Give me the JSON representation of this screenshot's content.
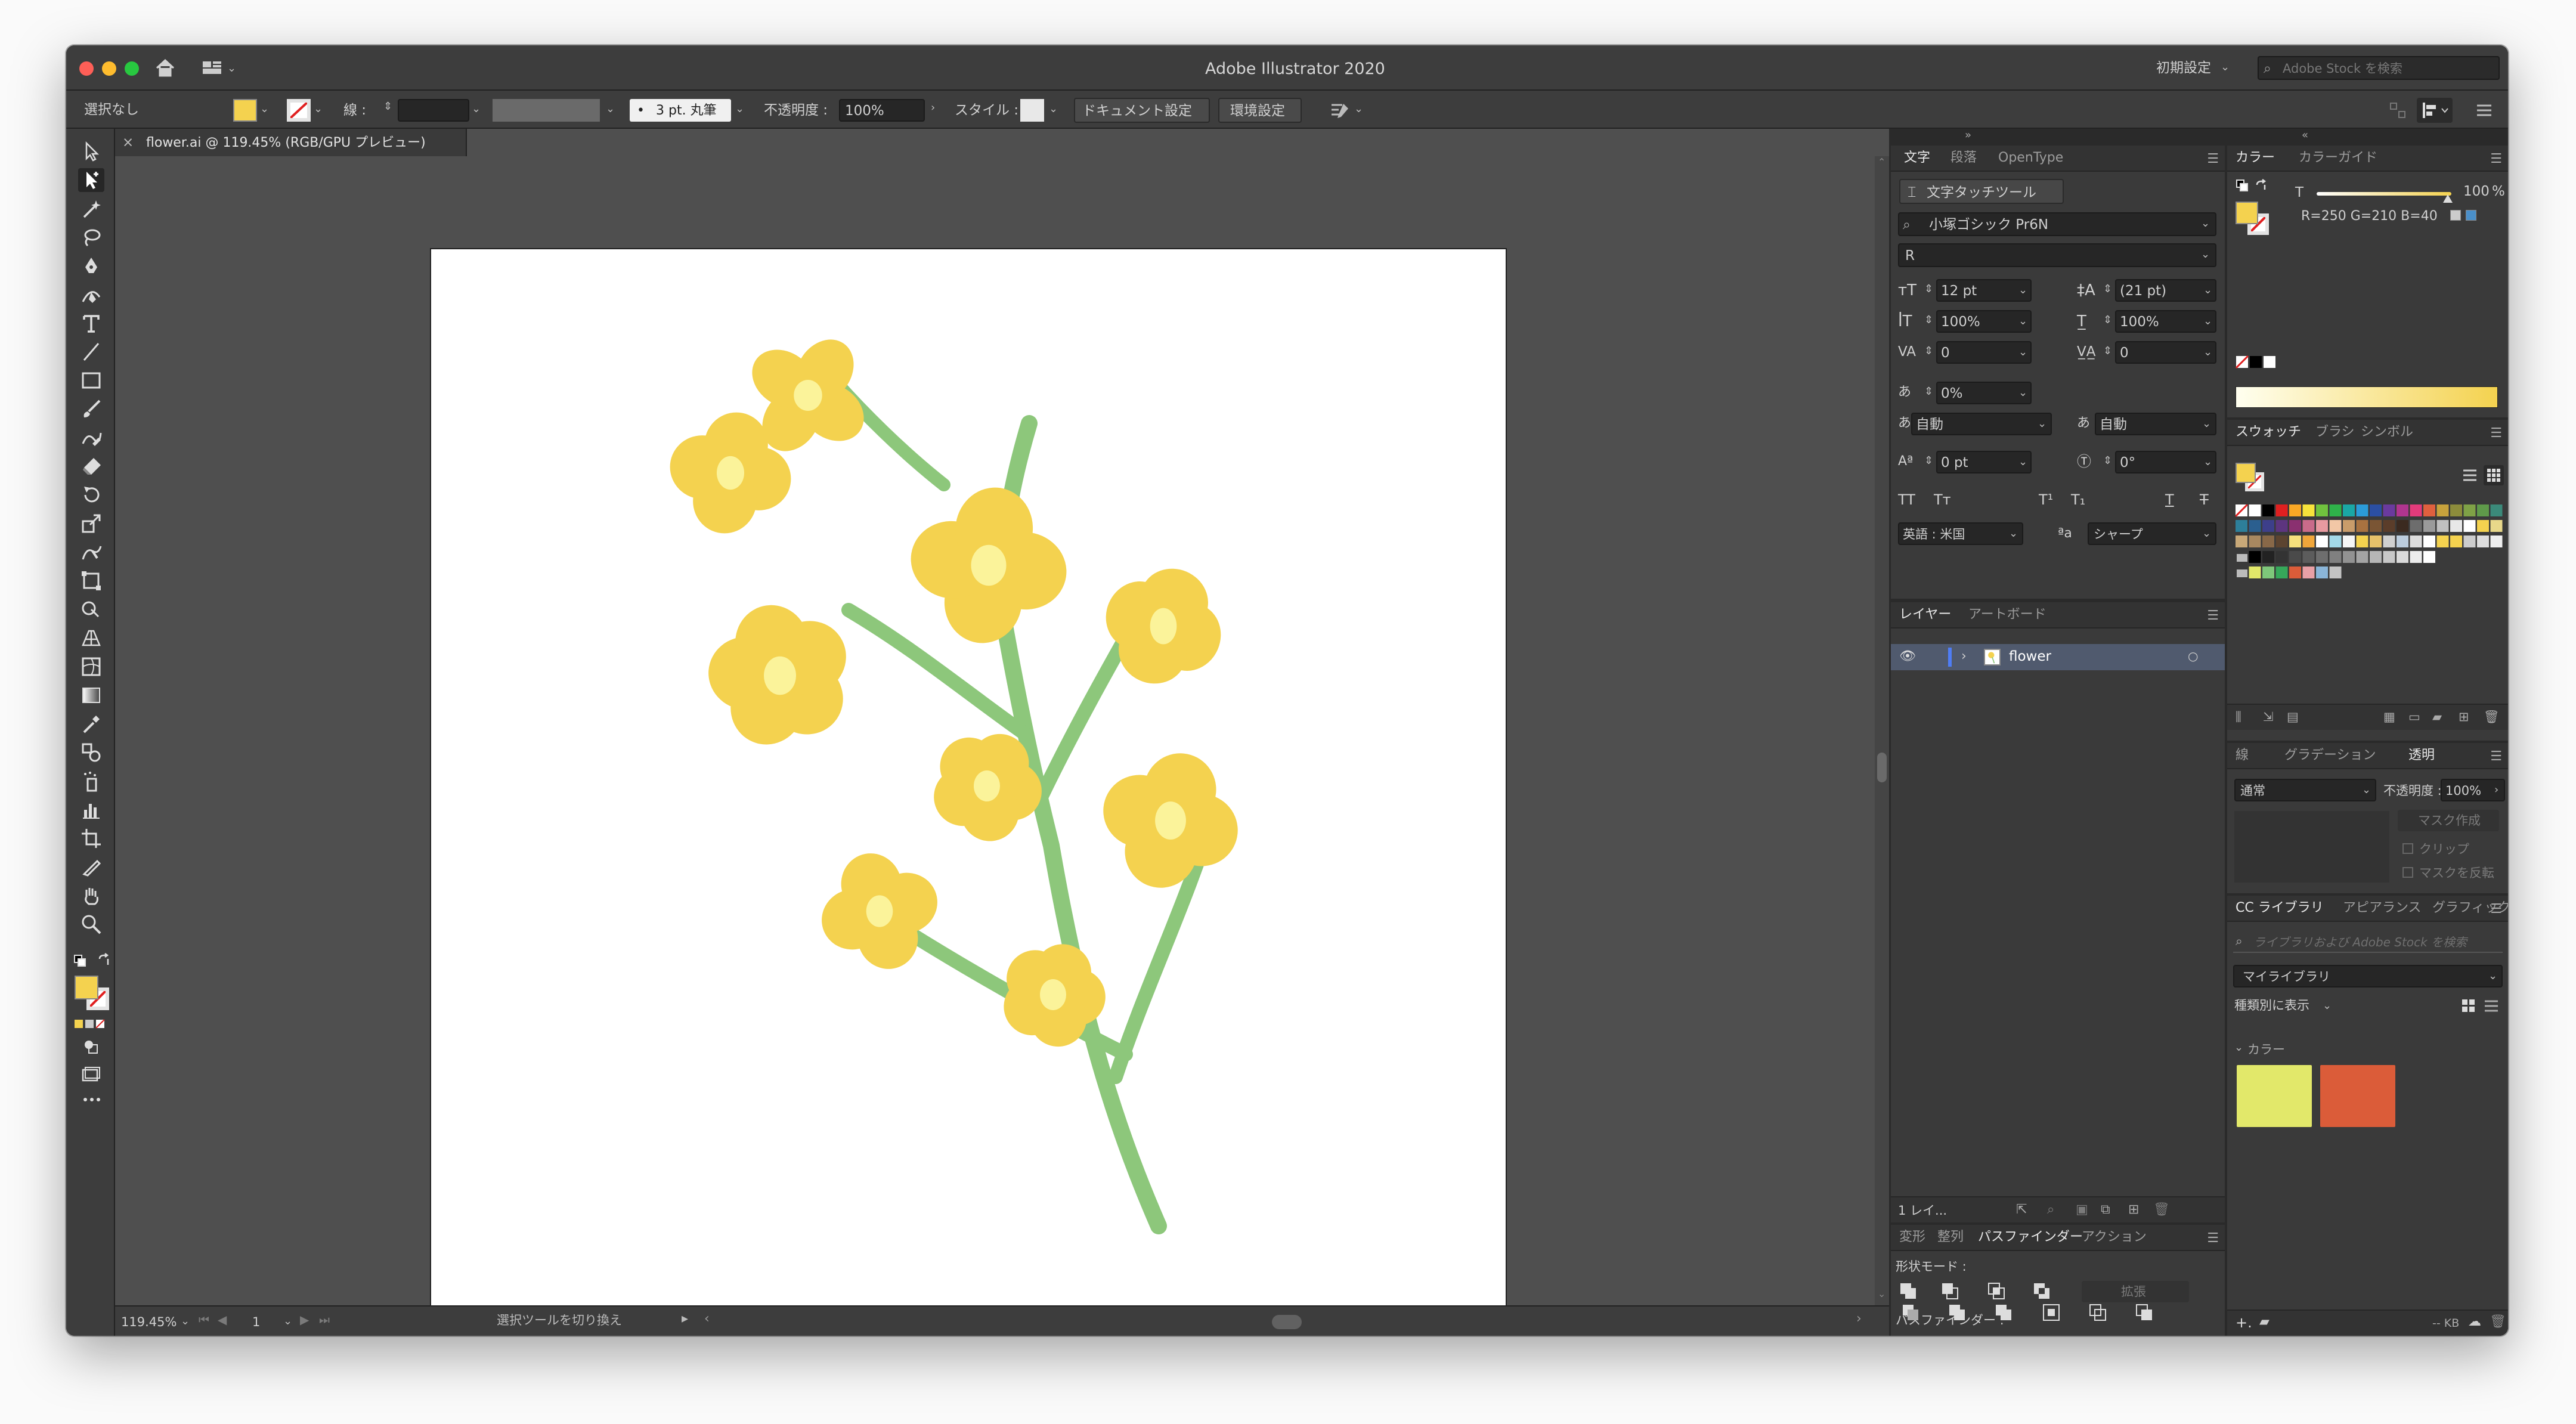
{
  "app": {
    "title": "Adobe Illustrator 2020",
    "workspace": "初期設定",
    "stock_search_placeholder": "Adobe Stock を検索"
  },
  "control_bar": {
    "selection": "選択なし",
    "stroke_label": "線 :",
    "brush": "3 pt. 丸筆",
    "opacity_label": "不透明度 :",
    "opacity_value": "100%",
    "style_label": "スタイル :",
    "document_setup": "ドキュメント設定",
    "preferences": "環境設定",
    "fill_color": "#f4d24f"
  },
  "document": {
    "tab_title": "flower.ai @ 119.45% (RGB/GPU プレビュー)",
    "zoom": "119.45%",
    "artboard_number": "1",
    "status_text": "選択ツールを切り換え"
  },
  "type_panel": {
    "tabs": [
      "文字",
      "段落",
      "OpenType"
    ],
    "touch_tool": "文字タッチツール",
    "font_family": "小塚ゴシック Pr6N",
    "font_style": "R",
    "font_size": "12 pt",
    "leading": "(21 pt)",
    "vertical_scale": "100%",
    "horizontal_scale": "100%",
    "kerning": "0",
    "tracking": "0",
    "tsume": "0%",
    "aki_left": "自動",
    "aki_right": "自動",
    "baseline_shift": "0 pt",
    "rotation": "0°",
    "language": "英語 : 米国",
    "antialias": "シャープ"
  },
  "layers_panel": {
    "tabs": [
      "レイヤー",
      "アートボード"
    ],
    "layers": [
      {
        "name": "flower"
      }
    ],
    "footer_count": "1 レイ..."
  },
  "pathfinder_panel": {
    "tabs": [
      "変形",
      "整列",
      "パスファインダー",
      "アクション"
    ],
    "shape_modes_label": "形状モード :",
    "expand_label": "拡張",
    "pathfinders_label": "パスファインダー :"
  },
  "color_panel": {
    "tabs": [
      "カラー",
      "カラーガイド"
    ],
    "tint_label": "T",
    "tint_value": "100",
    "tint_unit": "%",
    "rgb_text": "R=250 G=210 B=40",
    "color": "#f4d24f"
  },
  "swatches_panel": {
    "tabs": [
      "スウォッチ",
      "ブラシ",
      "シンボル"
    ]
  },
  "transparency_panel": {
    "tabs": [
      "線",
      "グラデーション",
      "透明"
    ],
    "blend_mode": "通常",
    "opacity_label": "不透明度 :",
    "opacity_value": "100%",
    "make_mask": "マスク作成",
    "clip": "クリップ",
    "invert_mask": "マスクを反転"
  },
  "libraries_panel": {
    "tabs": [
      "CC ライブラリ",
      "アピアランス",
      "グラフィック"
    ],
    "search_placeholder": "ライブラリおよび Adobe Stock を検索",
    "library": "マイライブラリ",
    "view_by": "種類別に表示",
    "section": "カラー",
    "colors": [
      "#e2e86a",
      "#db5c39"
    ],
    "footer_size": "-- KB"
  },
  "flower": {
    "petal_color": "#f4d24f",
    "center_color": "#fbf39a",
    "stem_color": "#8dc77b"
  }
}
